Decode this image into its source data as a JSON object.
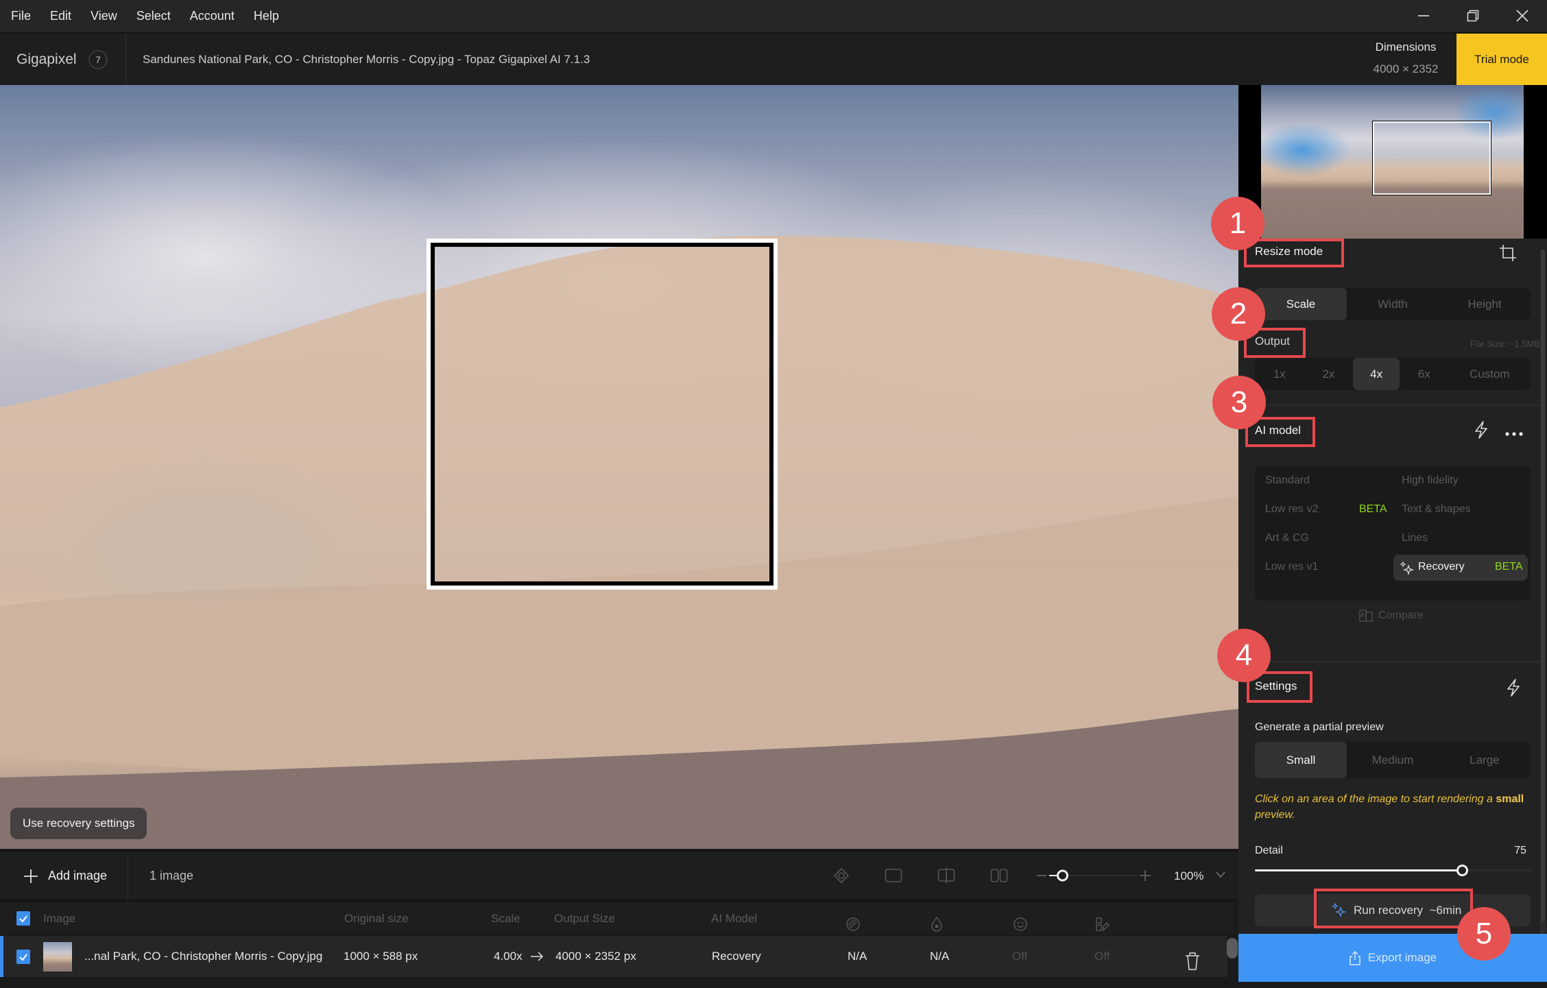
{
  "menu": [
    "File",
    "Edit",
    "View",
    "Select",
    "Account",
    "Help"
  ],
  "window_controls": {
    "minimize": "minimize-icon",
    "restore": "restore-icon",
    "close": "close-icon"
  },
  "header": {
    "app_name": "Gigapixel",
    "app_badge": "7",
    "file_title": "Sandunes National Park, CO - Christopher Morris - Copy.jpg - Topaz Gigapixel AI 7.1.3",
    "dimensions_label": "Dimensions",
    "dimensions_value": "4000 × 2352",
    "trial_label": "Trial mode"
  },
  "canvas": {
    "use_recovery_label": "Use recovery settings"
  },
  "toolbar": {
    "add_image_label": "Add image",
    "image_count": "1 image",
    "view_icons": [
      "eye-icon",
      "single-view-icon",
      "split-view-icon",
      "side-by-side-icon"
    ],
    "zoom_percent": "100%",
    "zoom_slider_value": 0.15
  },
  "table": {
    "headers": {
      "image": "Image",
      "original_size": "Original size",
      "scale": "Scale",
      "output_size": "Output Size",
      "ai_model": "AI Model",
      "icon_cols": [
        "denoise-icon",
        "sharpen-icon",
        "face-recovery-icon",
        "color-icon"
      ]
    },
    "rows": [
      {
        "checked": true,
        "name": "...nal Park, CO - Christopher Morris - Copy.jpg",
        "original_size": "1000 × 588 px",
        "scale": "4.00x",
        "output_size": "4000 × 2352 px",
        "ai_model": "Recovery",
        "col1": "N/A",
        "col2": "N/A",
        "col3": "Off",
        "col4": "Off"
      }
    ]
  },
  "panel": {
    "resize_mode": {
      "title": "Resize mode",
      "options": [
        "Scale",
        "Width",
        "Height"
      ],
      "active": "Scale"
    },
    "output": {
      "title": "Output",
      "file_size": "File Size: ~1.5MB",
      "options": [
        "1x",
        "2x",
        "4x",
        "6x",
        "Custom"
      ],
      "active": "4x"
    },
    "ai_model": {
      "title": "AI model",
      "left": [
        "Standard",
        "Low res v2",
        "Art & CG",
        "Low res v1"
      ],
      "right": [
        "High fidelity",
        "Text & shapes",
        "Lines",
        "Recovery"
      ],
      "beta_label": "BETA",
      "selected": "Recovery",
      "compare_label": "Compare"
    },
    "settings": {
      "title": "Settings",
      "preview_label": "Generate a partial preview",
      "preview_options": [
        "Small",
        "Medium",
        "Large"
      ],
      "preview_active": "Small",
      "hint_prefix": "Click on an area of the image to start rendering a ",
      "hint_bold": "small",
      "hint_suffix": " preview.",
      "detail_label": "Detail",
      "detail_value": "75",
      "detail_fraction": 0.75
    },
    "run_label": "Run recovery  ~6min",
    "export_label": "Export image"
  },
  "annotations": [
    "1",
    "2",
    "3",
    "4",
    "5"
  ],
  "colors": {
    "accent_blue": "#3f95f5",
    "trial_yellow": "#f7c520",
    "beta_green": "#8fd91c",
    "annotation_red": "#e65252",
    "hint_yellow": "#e8c23c"
  }
}
